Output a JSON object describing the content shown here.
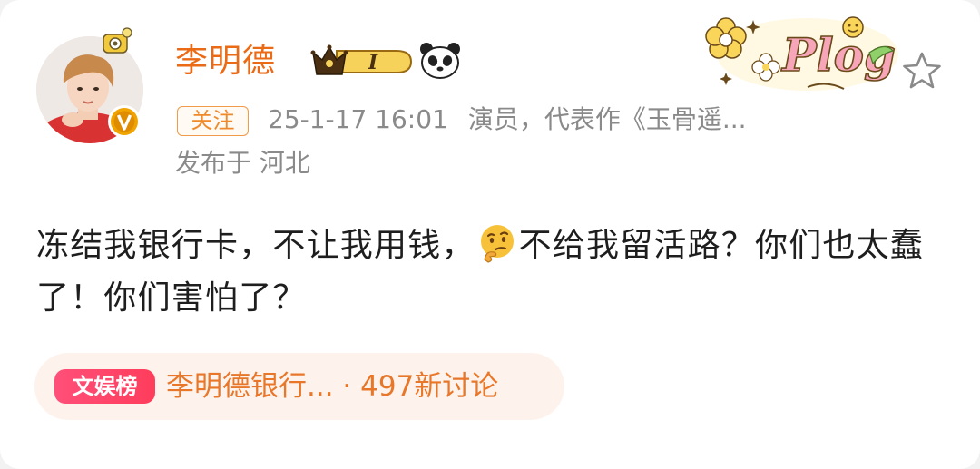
{
  "post": {
    "author": {
      "name": "李明德",
      "level_badge": "I"
    },
    "follow_label": "关注",
    "timestamp": "25-1-17 16:01",
    "author_desc": "演员，代表作《玉骨遥...",
    "location": "发布于 河北",
    "text_part1": "冻结我银行卡，不让我用钱，",
    "text_part2": "不给我留活路？你们也太蠢了！你们害怕了？",
    "sticker_text": "Plog",
    "topic": {
      "tag": "文娱榜",
      "title": "李明德银行... · 497新讨论"
    }
  },
  "colors": {
    "name": "#ea6a16",
    "meta": "#8a8a8a",
    "follow_border": "#f09a4a",
    "topic_bg": "#fdf3ec",
    "topic_tag": "#ff4f79",
    "topic_text": "#e8772a"
  },
  "icons": {
    "avatar_pendant": "camera-pendant-icon",
    "verified": "verified-badge-icon",
    "crown": "crown-level-badge-icon",
    "panda": "panda-icon",
    "sticker": "plog-flower-sticker",
    "star": "star-outline-icon",
    "emoji": "thinking-face-emoji"
  }
}
